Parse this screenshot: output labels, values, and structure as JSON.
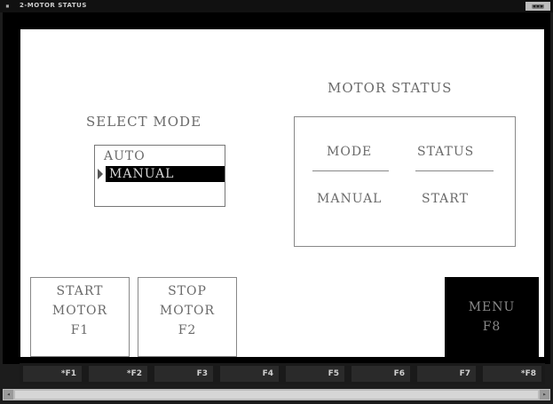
{
  "window": {
    "title": "2-MOTOR STATUS",
    "controls": "▣▣▣"
  },
  "screen": {
    "motor_status_title": "MOTOR STATUS",
    "select_mode_title": "SELECT MODE",
    "mode_options": [
      "AUTO",
      "MANUAL"
    ],
    "selected_mode": "MANUAL",
    "status_table": {
      "headers": [
        "MODE",
        "STATUS"
      ],
      "values": [
        "MANUAL",
        "START"
      ]
    },
    "buttons": {
      "start_motor": [
        "START",
        "MOTOR",
        "F1"
      ],
      "stop_motor": [
        "STOP",
        "MOTOR",
        "F2"
      ],
      "menu": [
        "MENU",
        "F8"
      ]
    }
  },
  "function_bar": {
    "keys": [
      "*F1",
      "*F2",
      "F3",
      "F4",
      "F5",
      "F6",
      "F7",
      "*F8"
    ]
  },
  "colors": {
    "background": "#000000",
    "screen": "#ffffff",
    "text": "#6a6a6a",
    "selection": "#000000"
  },
  "icons": {
    "pointer": "triangle-right-icon"
  }
}
